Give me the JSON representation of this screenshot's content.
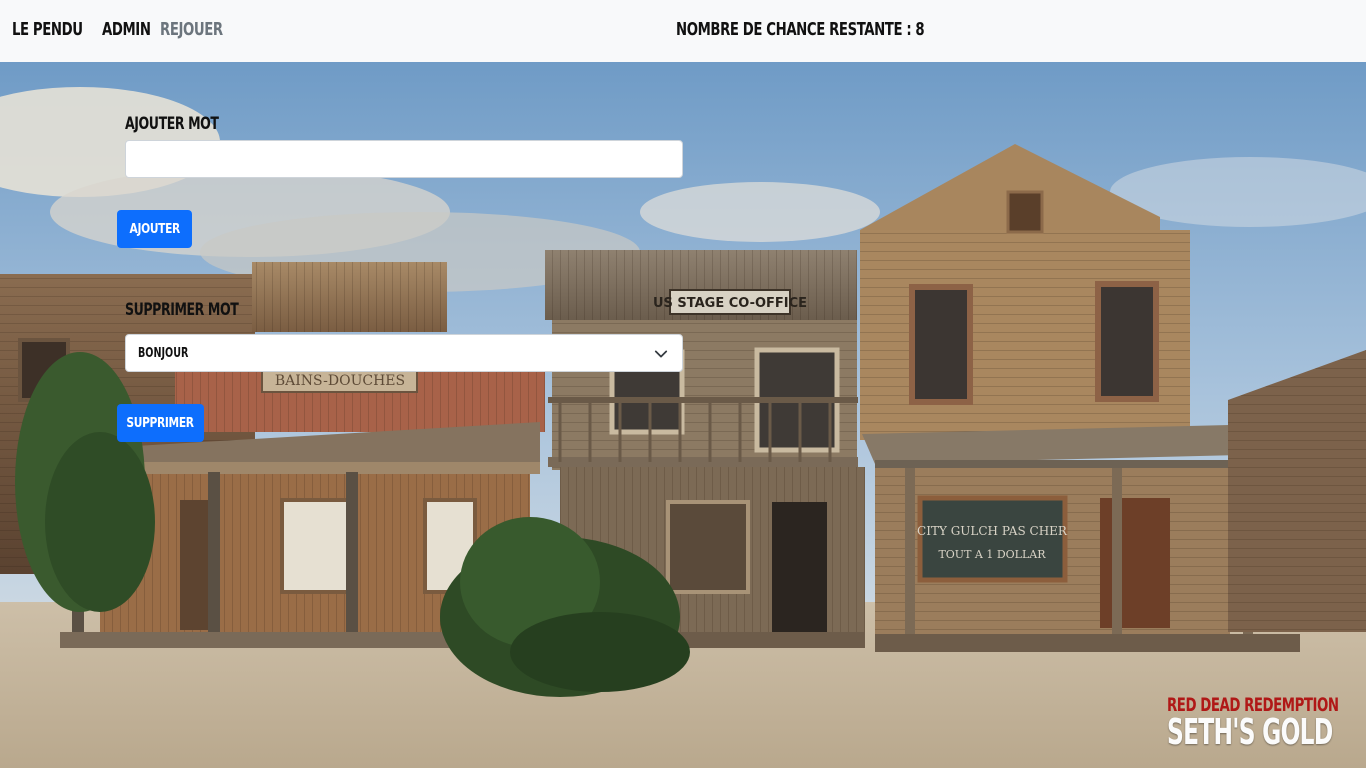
{
  "nav": {
    "brand": "LE PENDU",
    "admin": "ADMIN",
    "replay": "REJOUER",
    "status": "NOMBRE DE CHANCE RESTANTE : 8"
  },
  "add_form": {
    "label": "AJOUTER MOT",
    "input_value": "",
    "button": "AJOUTER"
  },
  "delete_form": {
    "label": "SUPPRIMER MOT",
    "selected": "BONJOUR",
    "button": "SUPPRIMER"
  },
  "logo": {
    "line1": "RED DEAD REDEMPTION",
    "line2": "SETH'S GOLD"
  },
  "scene_signs": {
    "bath": "BAINS-DOUCHES",
    "stage": "US STAGE CO-OFFICE",
    "store_line1": "CITY GULCH PAS CHER",
    "store_line2": "TOUT A 1 DOLLAR"
  },
  "colors": {
    "accent": "#0d6efd",
    "navbar_bg": "#f8f9fa",
    "logo_red": "#b01817"
  }
}
